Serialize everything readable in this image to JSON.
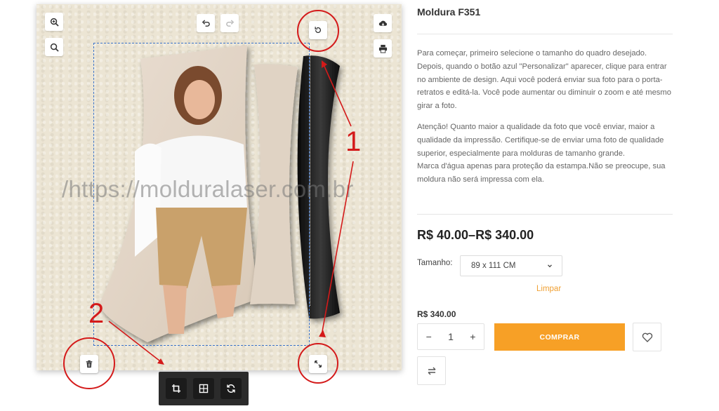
{
  "editor": {
    "watermark": "/https://molduralaser.com.br",
    "tools": {
      "zoom_in": "zoom-in-icon",
      "zoom_out": "zoom-out-icon",
      "undo": "undo-icon",
      "redo": "redo-icon",
      "upload": "cloud-download-icon",
      "print": "print-icon"
    },
    "handles": {
      "rotate": "rotate-icon",
      "delete": "trash-icon",
      "resize": "resize-icon"
    },
    "bottom_toolbar": [
      "crop-icon",
      "grid-icon",
      "refresh-icon"
    ],
    "annotations": [
      "1",
      "2"
    ],
    "colors": {
      "selection": "#3a73c9",
      "annotation": "#d41a1a"
    }
  },
  "product": {
    "title": "Moldura F351",
    "description": [
      "Para começar, primeiro selecione o tamanho do quadro desejado. Depois, quando o botão azul \"Personalizar\" aparecer, clique para entrar no ambiente de design. Aqui você poderá enviar sua foto para o porta-retratos e editá-la. Você pode aumentar ou diminuir o zoom e até mesmo girar a foto.",
      "Atenção! Quanto maior a qualidade da foto que você enviar, maior a qualidade da impressão. Certifique-se de enviar uma foto de qualidade superior, especialmente para molduras de tamanho grande.",
      "Marca d'água apenas para proteção da estampa.Não se preocupe, sua moldura não será impressa com ela."
    ],
    "price_range": "R$ 40.00–R$ 340.00",
    "size_label": "Tamanho:",
    "size_value": "89 x 111 CM",
    "clear_label": "Limpar",
    "unit_price": "R$ 340.00",
    "quantity": {
      "minus": "−",
      "value": "1",
      "plus": "+"
    },
    "buy_label": "COMPRAR",
    "wishlist_icon": "heart-icon",
    "compare_icon": "compare-icon",
    "colors": {
      "buy_button": "#f7a026",
      "clear_link": "#f0a033"
    }
  }
}
